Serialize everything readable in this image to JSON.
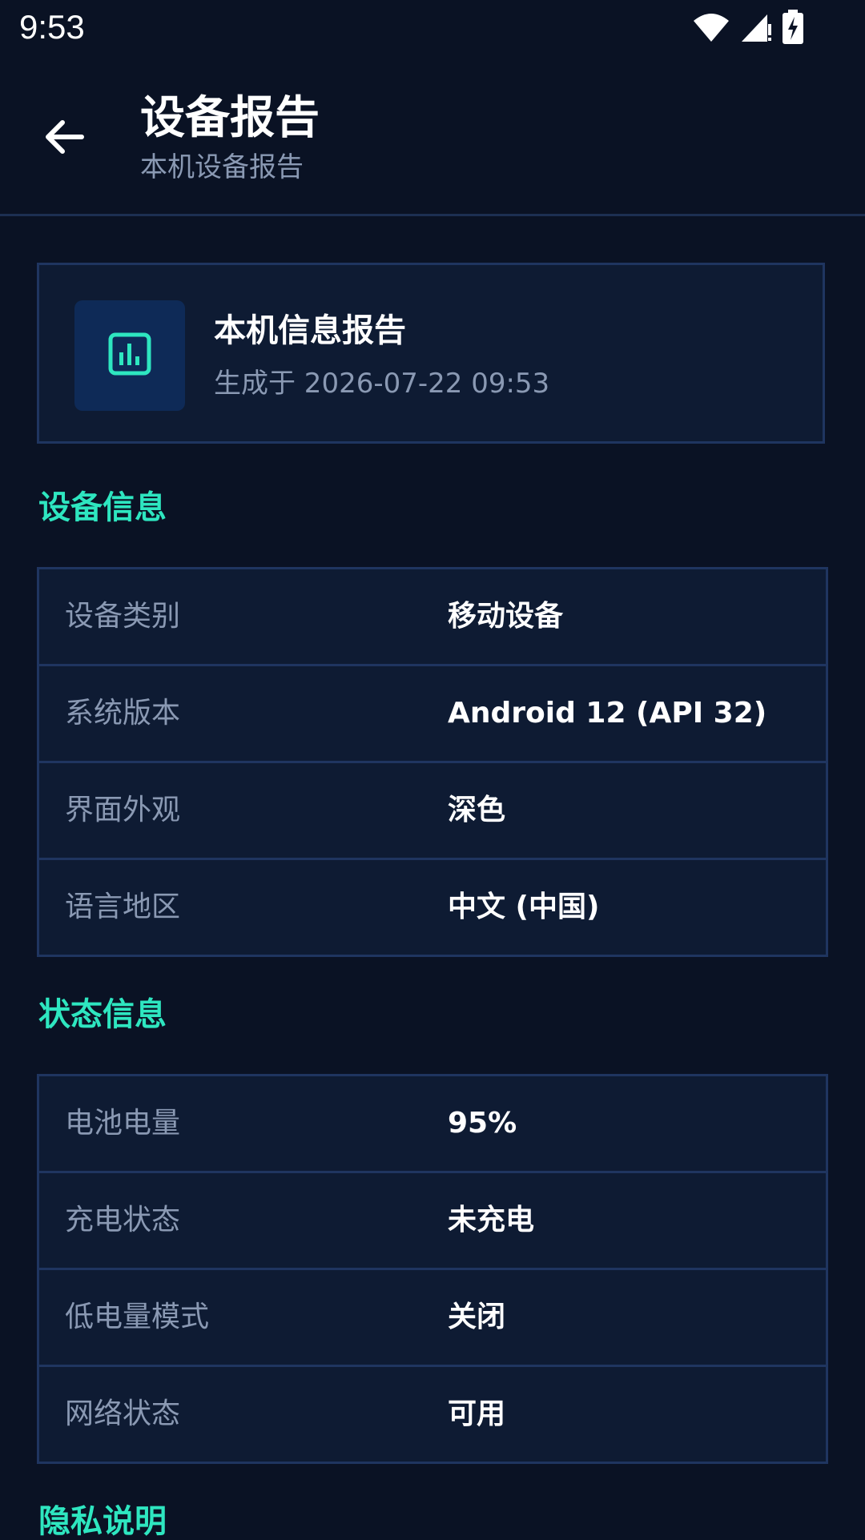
{
  "status_bar": {
    "time": "9:53"
  },
  "header": {
    "title": "设备报告",
    "subtitle": "本机设备报告"
  },
  "summary": {
    "title": "本机信息报告",
    "generated": "生成于 2026-07-22 09:53"
  },
  "sections": [
    {
      "heading": "设备信息",
      "rows": [
        {
          "label": "设备类别",
          "value": "移动设备"
        },
        {
          "label": "系统版本",
          "value": "Android 12 (API 32)"
        },
        {
          "label": "界面外观",
          "value": "深色"
        },
        {
          "label": "语言地区",
          "value": "中文 (中国)"
        }
      ]
    },
    {
      "heading": "状态信息",
      "rows": [
        {
          "label": "电池电量",
          "value": "95%"
        },
        {
          "label": "充电状态",
          "value": "未充电"
        },
        {
          "label": "低电量模式",
          "value": "关闭"
        },
        {
          "label": "网络状态",
          "value": "可用"
        }
      ]
    },
    {
      "heading": "隐私说明"
    }
  ],
  "colors": {
    "background": "#0a1224",
    "card": "#0e1b33",
    "border": "#1f3560",
    "accent": "#2ee6c0",
    "muted_text": "#8a99b3"
  },
  "icons": {
    "back": "arrow-left-icon",
    "report": "bar-chart-icon",
    "wifi": "wifi-icon",
    "signal": "cell-signal-icon",
    "battery": "battery-charging-icon"
  }
}
